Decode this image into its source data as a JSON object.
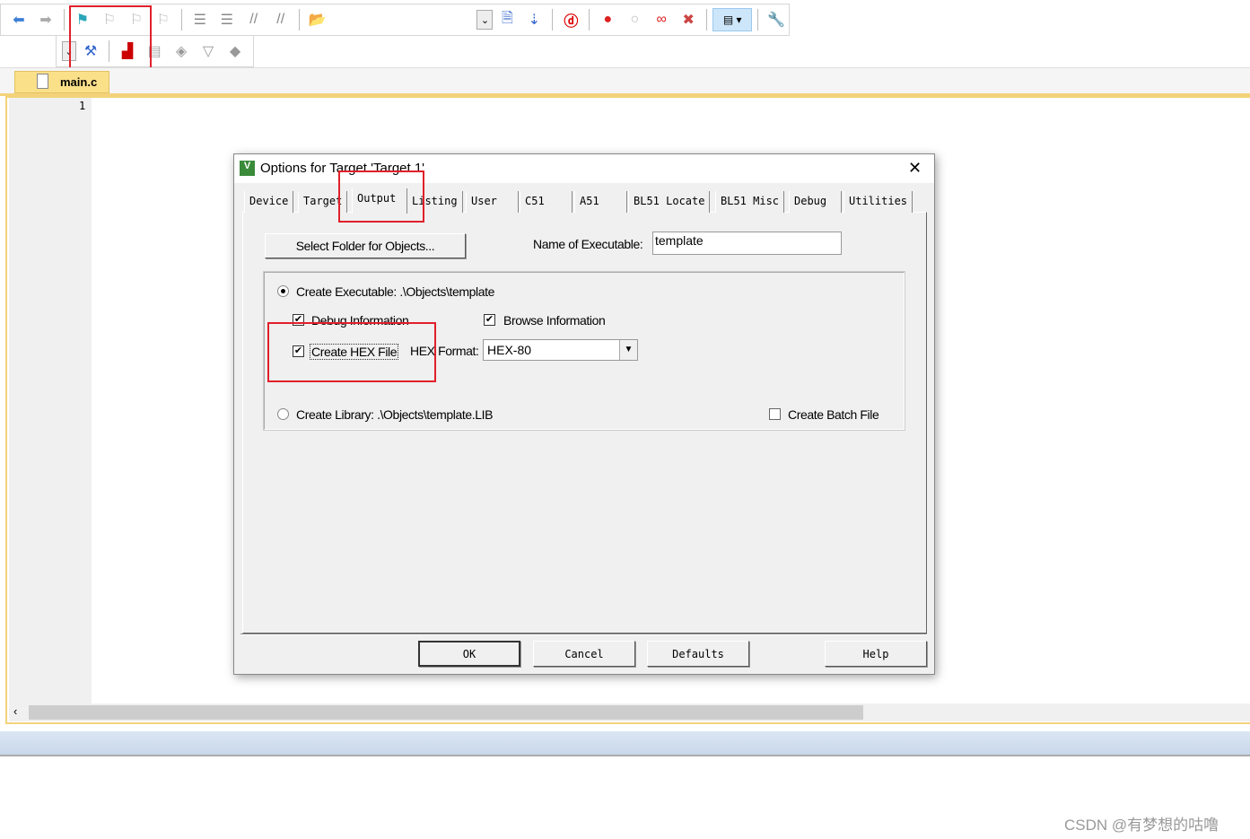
{
  "toolbar1": {
    "icons": [
      "back-arrow-icon",
      "forward-arrow-icon",
      "bookmark-flag-icon",
      "prev-bookmark-icon",
      "next-bookmark-icon",
      "clear-bookmarks-icon",
      "indent-icon",
      "unindent-icon",
      "comment-icon",
      "uncomment-icon",
      "find-in-files-icon",
      "find-dropdown-icon",
      "incremental-find-icon",
      "browse-symbols-icon",
      "debug-session-icon",
      "breakpoint-icon",
      "disable-breakpoint-icon",
      "disable-all-breakpoints-icon",
      "kill-breakpoints-icon",
      "window-layout-icon",
      "configure-icon"
    ]
  },
  "toolbar2": {
    "icons": [
      "target-dropdown-icon",
      "options-for-target-icon",
      "manage-components-icon",
      "file-extensions-icon",
      "select-packs-icon",
      "batch-build-icon",
      "pack-installer-icon"
    ]
  },
  "editor": {
    "tab": "main.c",
    "line_numbers": [
      "1"
    ]
  },
  "dialog": {
    "title": "Options for Target 'Target 1'",
    "tabs": [
      "Device",
      "Target",
      "Output",
      "Listing",
      "User",
      "C51",
      "A51",
      "BL51 Locate",
      "BL51 Misc",
      "Debug",
      "Utilities"
    ],
    "active_tab": "Output",
    "select_folder_label": "Select Folder for Objects...",
    "name_of_executable_label": "Name of Executable:",
    "name_of_executable_value": "template",
    "create_executable_label": "Create Executable:  .\\Objects\\template",
    "debug_info_label": "Debug Information",
    "debug_info_checked": true,
    "browse_info_label": "Browse Information",
    "browse_info_checked": true,
    "create_hex_label": "Create HEX File",
    "create_hex_checked": true,
    "hex_format_label": "HEX Format:",
    "hex_format_value": "HEX-80",
    "create_library_label": "Create Library:  .\\Objects\\template.LIB",
    "create_batch_label": "Create Batch File",
    "create_batch_checked": false,
    "buttons": {
      "ok": "OK",
      "cancel": "Cancel",
      "defaults": "Defaults",
      "help": "Help"
    }
  },
  "watermark": "CSDN @有梦想的咕噜",
  "colors": {
    "highlight": "#e0202a",
    "tab_bg": "#fbe08a"
  }
}
